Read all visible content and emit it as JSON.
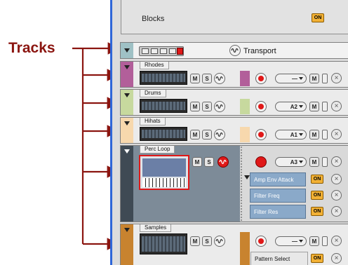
{
  "annotation": {
    "tracks_label": "Tracks"
  },
  "blocks": {
    "label": "Blocks",
    "on_label": "ON"
  },
  "transport": {
    "label": "Transport"
  },
  "tracks": [
    {
      "name": "Rhodes",
      "mute": "M",
      "solo": "S",
      "pattern": "—",
      "m2": "M"
    },
    {
      "name": "Drums",
      "mute": "M",
      "solo": "S",
      "pattern": "A2",
      "m2": "M"
    },
    {
      "name": "Hihats",
      "mute": "M",
      "solo": "S",
      "pattern": "A1",
      "m2": "M"
    },
    {
      "name": "Perc Loop",
      "mute": "M",
      "solo": "S",
      "pattern": "A3",
      "m2": "M",
      "params": [
        {
          "label": "Amp Env Attack",
          "on": "ON"
        },
        {
          "label": "Filter Freq",
          "on": "ON"
        },
        {
          "label": "Filter Res",
          "on": "ON"
        }
      ]
    },
    {
      "name": "Samples",
      "mute": "M",
      "solo": "S",
      "pattern": "—",
      "m2": "M",
      "params": [
        {
          "label": "Pattern Select",
          "on": "ON"
        }
      ]
    }
  ],
  "colors": {
    "transport": "#9fc1c5",
    "rhodes": "#b25f9a",
    "drums": "#c7d99e",
    "hihats": "#f7d8ad",
    "perc": "#5a6a78",
    "samples": "#c8832f",
    "arrow": "#8b1510",
    "sidebar": "#2f66d8"
  }
}
